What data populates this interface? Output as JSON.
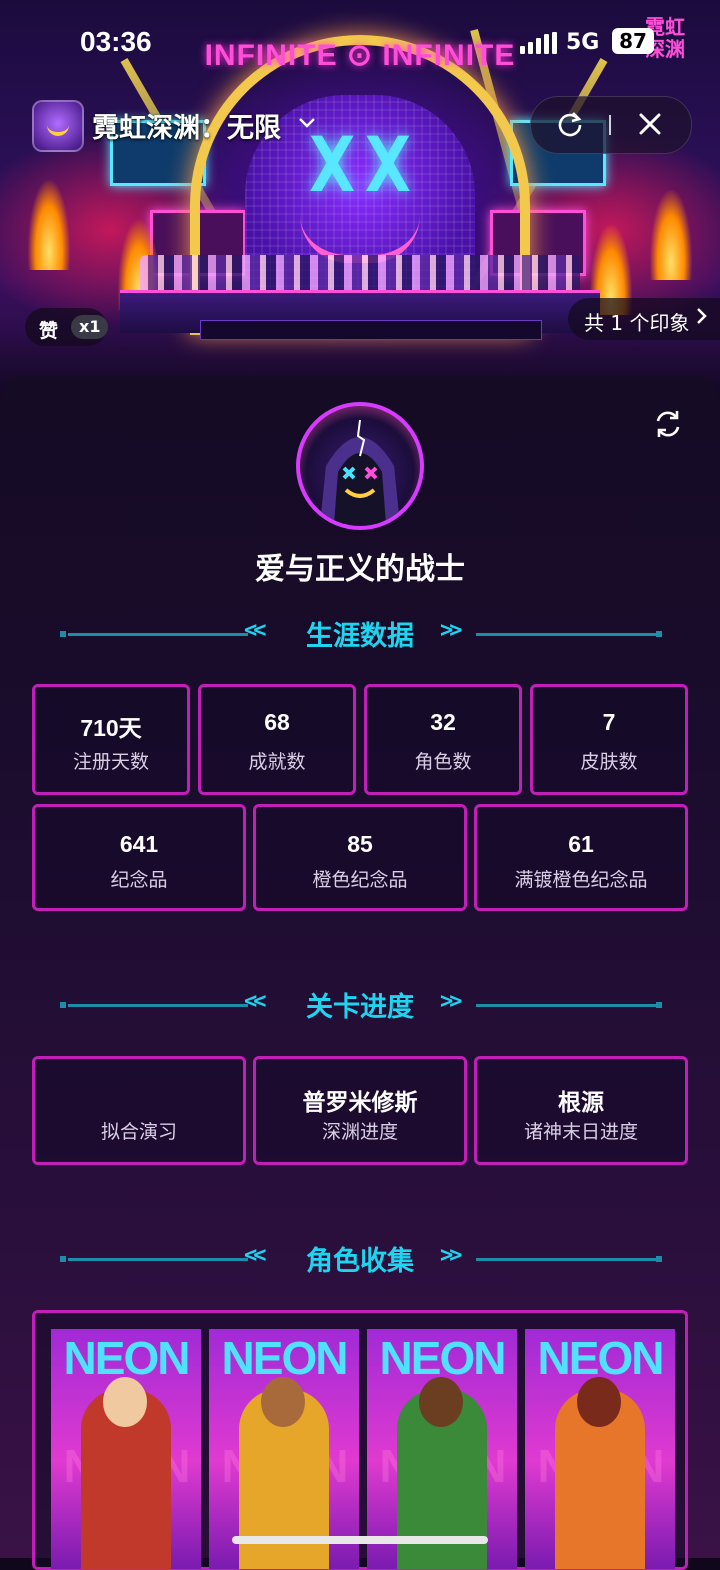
{
  "status_bar": {
    "time": "03:36",
    "network": "5G",
    "battery": "87"
  },
  "app": {
    "title": "霓虹深渊：无限"
  },
  "banner": {
    "marquee": "INFINITE ⊙ INFINITE",
    "logo_top": "霓虹",
    "logo_bottom": "深渊",
    "like_label": "赞",
    "like_count": "x1",
    "impressions": "共 1 个印象"
  },
  "profile": {
    "nickname": "爱与正义的战士"
  },
  "sections": {
    "career": "生涯数据",
    "progress": "关卡进度",
    "roles": "角色收集"
  },
  "career_stats": [
    {
      "value": "710天",
      "label": "注册天数"
    },
    {
      "value": "68",
      "label": "成就数"
    },
    {
      "value": "32",
      "label": "角色数"
    },
    {
      "value": "7",
      "label": "皮肤数"
    },
    {
      "value": "641",
      "label": "纪念品"
    },
    {
      "value": "85",
      "label": "橙色纪念品"
    },
    {
      "value": "61",
      "label": "满镀橙色纪念品"
    }
  ],
  "progress_stats": [
    {
      "value": "",
      "label": "拟合演习"
    },
    {
      "value": "普罗米修斯",
      "label": "深渊进度"
    },
    {
      "value": "根源",
      "label": "诸神末日进度"
    }
  ],
  "characters": [
    {
      "banner": "NEON",
      "icon": "character-soldier-icon"
    },
    {
      "banner": "NEON",
      "icon": "character-gunner-girl-icon"
    },
    {
      "banner": "NEON",
      "icon": "character-brawler-icon"
    },
    {
      "banner": "NEON",
      "icon": "character-martial-artist-icon"
    }
  ],
  "colors": {
    "accent_cyan": "#1fd4ef",
    "card_border": "#c21fb8",
    "background": "#10071c"
  }
}
